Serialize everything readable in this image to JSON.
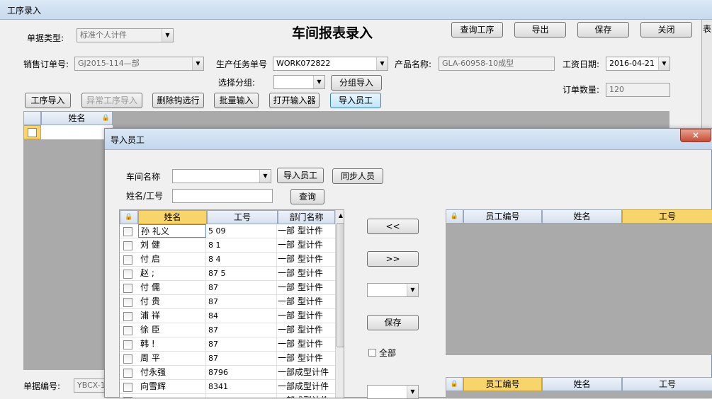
{
  "main_window": {
    "title": "工序录入",
    "form_title": "车间报表录入",
    "buttons": {
      "query": "查询工序",
      "export": "导出",
      "save": "保存",
      "close": "关闭"
    },
    "doc_type_label": "单据类型:",
    "doc_type_value": "标准个人计件",
    "sales_order_label": "销售订单号:",
    "sales_order_value": "GJ2015-114—部",
    "task_label": "生产任务单号",
    "task_value": "WORK072822",
    "product_label": "产品名称:",
    "product_value": "GLA-60958-10成型",
    "wage_date_label": "工资日期:",
    "wage_date_value": "2016-04-21",
    "group_label": "选择分组:",
    "group_value": "",
    "group_import": "分组导入",
    "order_qty_label": "订单数量:",
    "order_qty_value": "120",
    "toolbar": [
      "工序导入",
      "异常工序导入",
      "删除钩选行",
      "批量输入",
      "打开输入器",
      "导入员工"
    ],
    "grid_header": "姓名",
    "doc_no_label": "单据编号:",
    "doc_no_value": "YBCX-1",
    "right_edge": "表"
  },
  "dialog": {
    "title": "导入员工",
    "close": "×",
    "workshop_label": "车间名称",
    "workshop_value": "",
    "import_button": "导入员工",
    "sync_button": "同步人员",
    "name_id_label": "姓名/工号",
    "name_id_value": "",
    "search_button": "查询",
    "left_grid": {
      "columns": [
        "姓名",
        "工号",
        "部门名称"
      ],
      "rows": [
        {
          "name": "孙 礼义",
          "id": "5 09",
          "dept": "一部 型计件"
        },
        {
          "name": "刘 健",
          "id": "8 1",
          "dept": "一部 型计件"
        },
        {
          "name": "付 启",
          "id": "8 4",
          "dept": "一部 型计件"
        },
        {
          "name": "赵 ;",
          "id": "87 5",
          "dept": "一部 型计件"
        },
        {
          "name": "付 儒",
          "id": "87 ",
          "dept": "一部 型计件"
        },
        {
          "name": "付 贵",
          "id": "87",
          "dept": "一部 型计件"
        },
        {
          "name": "浦 祥",
          "id": "84",
          "dept": "一部 型计件"
        },
        {
          "name": "徐 臣",
          "id": "87",
          "dept": "一部 型计件"
        },
        {
          "name": "韩 !",
          "id": "87",
          "dept": "一部 型计件"
        },
        {
          "name": "周 平",
          "id": "87",
          "dept": "一部 型计件"
        },
        {
          "name": "付永强",
          "id": "8796",
          "dept": "一部成型计件"
        },
        {
          "name": "向雪辉",
          "id": "8341",
          "dept": "一部成型计件"
        },
        {
          "name": "",
          "id": "",
          "dept": "一部成型计件"
        }
      ]
    },
    "move_left": "<<",
    "move_right": ">>",
    "dropdown_value": "",
    "save_button": "保存",
    "all_label": "全部",
    "right_grid_top": {
      "columns": [
        "员工编号",
        "姓名",
        "工号"
      ]
    },
    "right_grid_bottom": {
      "columns": [
        "员工编号",
        "姓名",
        "工号"
      ]
    }
  },
  "colors": {
    "grid_gray": "#aaaaaa",
    "header_blue": "#d6e0ee",
    "selected_header": "#f8d56a"
  }
}
